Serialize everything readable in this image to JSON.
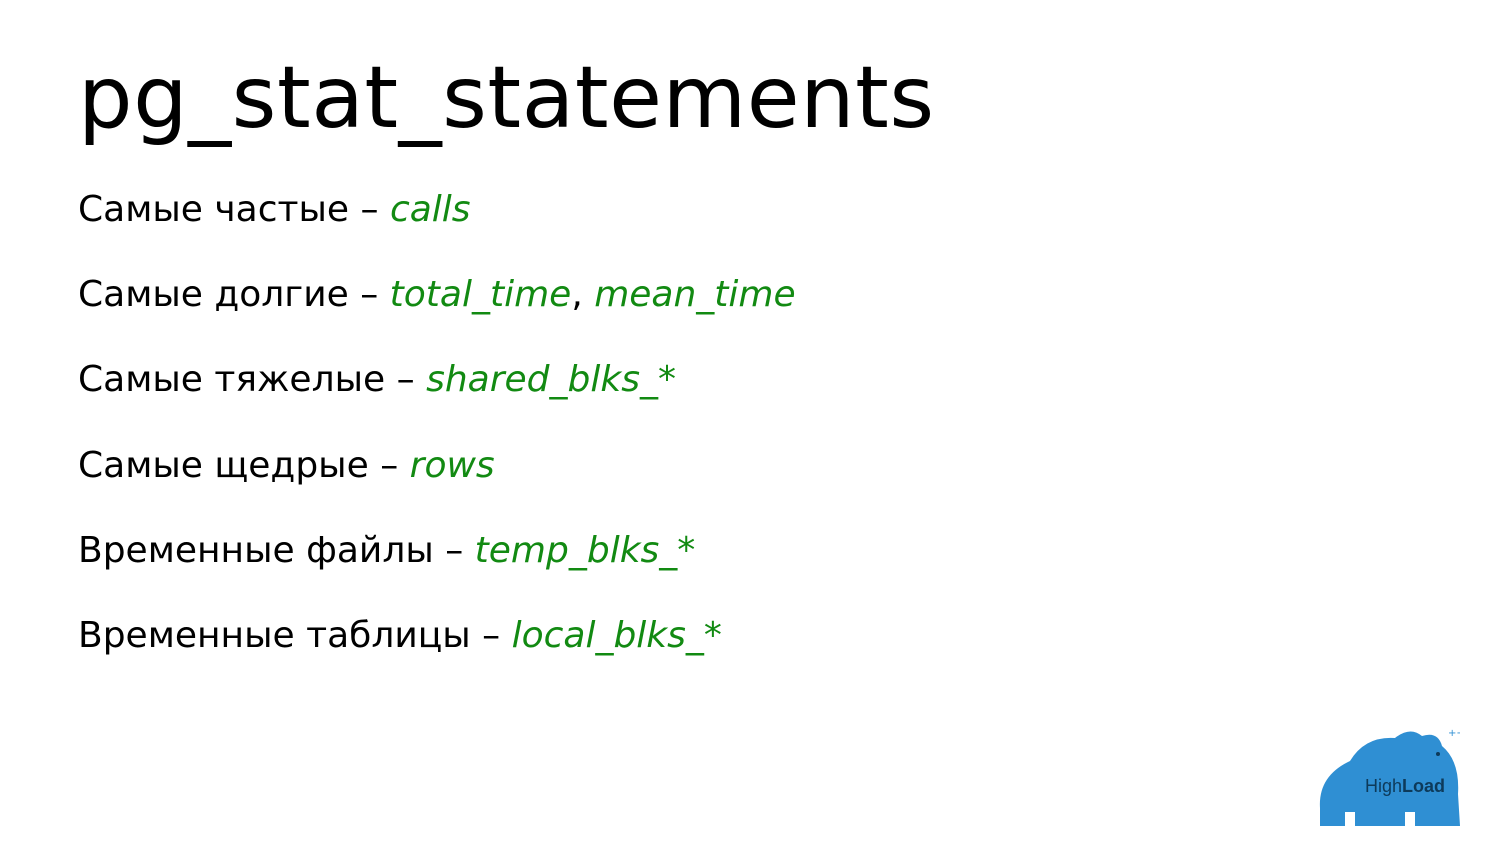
{
  "title": "pg_stat_statements",
  "items": [
    {
      "label": "Самые частые",
      "sep": " – ",
      "value": "calls"
    },
    {
      "label": "Самые долгие",
      "sep": " – ",
      "value": "total_time",
      "value2": "mean_time"
    },
    {
      "label": "Самые тяжелые",
      "sep": " – ",
      "value": "shared_blks_*"
    },
    {
      "label": "Самые щедрые",
      "sep": " – ",
      "value": "rows"
    },
    {
      "label": "Временные файлы",
      "sep": " – ",
      "value": "temp_blks_*"
    },
    {
      "label": "Временные таблицы",
      "sep": " – ",
      "value": "local_blks_*"
    }
  ],
  "logo": {
    "text_light": "High",
    "text_bold": "Load",
    "color": "#2f8fd3"
  }
}
